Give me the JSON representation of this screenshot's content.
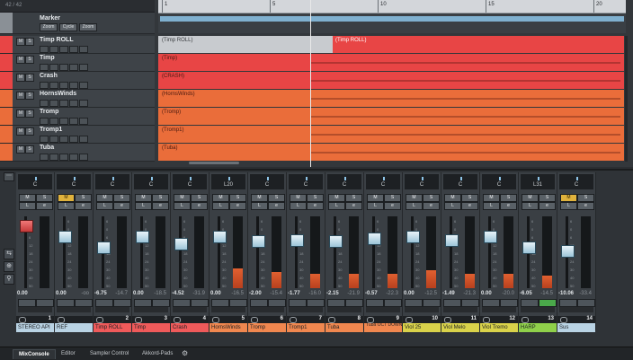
{
  "project": {
    "track_count": "42 / 42",
    "ruler": [
      "1",
      "5",
      "10",
      "15",
      "20"
    ],
    "marker": {
      "name": "Marker",
      "buttons": [
        "Zoom",
        "Cycle",
        "Zoom"
      ]
    },
    "tracks": [
      {
        "name": "Timp ROLL",
        "color": "#e84545",
        "event_left": "(Timp ROLL)",
        "event_right": "(Timp ROLL)"
      },
      {
        "name": "Timp",
        "color": "#e84545",
        "event_left": "(Timp)"
      },
      {
        "name": "Crash",
        "color": "#e84545",
        "event_left": "(CRASH)"
      },
      {
        "name": "HornsWinds",
        "color": "#ea6d3a",
        "event_left": "(HornsWinds)"
      },
      {
        "name": "Tromp",
        "color": "#ea6d3a",
        "event_left": "(Tromp)"
      },
      {
        "name": "Tromp1",
        "color": "#ea6d3a",
        "event_left": "(Tromp1)"
      },
      {
        "name": "Tuba",
        "color": "#ea6d3a",
        "event_left": "(Tuba)"
      }
    ]
  },
  "mixer": {
    "menu_icon": "ellipsis-icon",
    "channels": [
      {
        "name": "STEREO API",
        "num": "1",
        "pan": "C",
        "vol": "0.00",
        "peak": "",
        "plate": "#b9d3e4",
        "meter": 0.0,
        "fader": 0.88,
        "red": true,
        "m_hl": false,
        "w_green": false
      },
      {
        "name": "REF",
        "num": "",
        "pan": "C",
        "vol": "0.00",
        "peak": "-oo",
        "plate": "#b9d3e4",
        "meter": 0.0,
        "fader": 0.72,
        "red": false,
        "m_hl": true,
        "w_green": false
      },
      {
        "name": "Timp ROLL",
        "num": "2",
        "pan": "C",
        "vol": "-6.75",
        "peak": "-14.7",
        "plate": "#ef5a5a",
        "meter": 0.0,
        "fader": 0.58,
        "red": false,
        "m_hl": false,
        "w_green": false
      },
      {
        "name": "Timp",
        "num": "3",
        "pan": "C",
        "vol": "0.00",
        "peak": "-18.5",
        "plate": "#ef5a5a",
        "meter": 0.0,
        "fader": 0.72,
        "red": false,
        "m_hl": false,
        "w_green": false
      },
      {
        "name": "Crash",
        "num": "4",
        "pan": "C",
        "vol": "-4.52",
        "peak": "-31.9",
        "plate": "#ef5a5a",
        "meter": 0.0,
        "fader": 0.62,
        "red": false,
        "m_hl": false,
        "w_green": false
      },
      {
        "name": "HornsWinds",
        "num": "5",
        "pan": "L20",
        "vol": "0.00",
        "peak": "-16.5",
        "plate": "#f0874f",
        "meter": 0.28,
        "fader": 0.72,
        "red": false,
        "m_hl": false,
        "w_green": false
      },
      {
        "name": "Tromp",
        "num": "6",
        "pan": "C",
        "vol": "-2.00",
        "peak": "-15.4",
        "plate": "#f0874f",
        "meter": 0.22,
        "fader": 0.66,
        "red": false,
        "m_hl": false,
        "w_green": false
      },
      {
        "name": "Tromp1",
        "num": "7",
        "pan": "C",
        "vol": "-1.77",
        "peak": "-16.0",
        "plate": "#f0874f",
        "meter": 0.2,
        "fader": 0.67,
        "red": false,
        "m_hl": false,
        "w_green": false
      },
      {
        "name": "Tuba",
        "num": "8",
        "pan": "C",
        "vol": "-2.15",
        "peak": "-21.9",
        "plate": "#f0874f",
        "meter": 0.2,
        "fader": 0.66,
        "red": false,
        "m_hl": false,
        "w_green": false
      },
      {
        "name": "Tuba OCT DOWN",
        "num": "9",
        "pan": "C",
        "vol": "-0.57",
        "peak": "-22.3",
        "plate": "#f0874f",
        "meter": 0.2,
        "fader": 0.7,
        "red": false,
        "m_hl": false,
        "w_green": false
      },
      {
        "name": "Viol 25",
        "num": "10",
        "pan": "C",
        "vol": "0.00",
        "peak": "-12.5",
        "plate": "#d9d24a",
        "meter": 0.25,
        "fader": 0.72,
        "red": false,
        "m_hl": false,
        "w_green": false
      },
      {
        "name": "Viol Melo",
        "num": "11",
        "pan": "C",
        "vol": "-1.49",
        "peak": "-21.3",
        "plate": "#d9d24a",
        "meter": 0.2,
        "fader": 0.68,
        "red": false,
        "m_hl": false,
        "w_green": false
      },
      {
        "name": "Viol Tremo",
        "num": "12",
        "pan": "C",
        "vol": "0.00",
        "peak": "-20.0",
        "plate": "#d9d24a",
        "meter": 0.2,
        "fader": 0.72,
        "red": false,
        "m_hl": false,
        "w_green": false
      },
      {
        "name": "HARP",
        "num": "13",
        "pan": "L31",
        "vol": "-6.05",
        "peak": "-14.5",
        "plate": "#8fd04a",
        "meter": 0.18,
        "fader": 0.58,
        "red": false,
        "m_hl": false,
        "w_green": true
      },
      {
        "name": "Sus",
        "num": "14",
        "pan": "C",
        "vol": "-10.06",
        "peak": "-33.4",
        "plate": "#b9d3e4",
        "meter": 0.0,
        "fader": 0.52,
        "red": false,
        "m_hl": true,
        "w_green": false
      }
    ]
  },
  "tabs": [
    {
      "label": "MixConsole",
      "active": true
    },
    {
      "label": "Editor",
      "active": false
    },
    {
      "label": "Sampler Control",
      "active": false
    },
    {
      "label": "Akkord-Pads",
      "active": false
    }
  ],
  "tab_settings_icon": "gear-icon"
}
